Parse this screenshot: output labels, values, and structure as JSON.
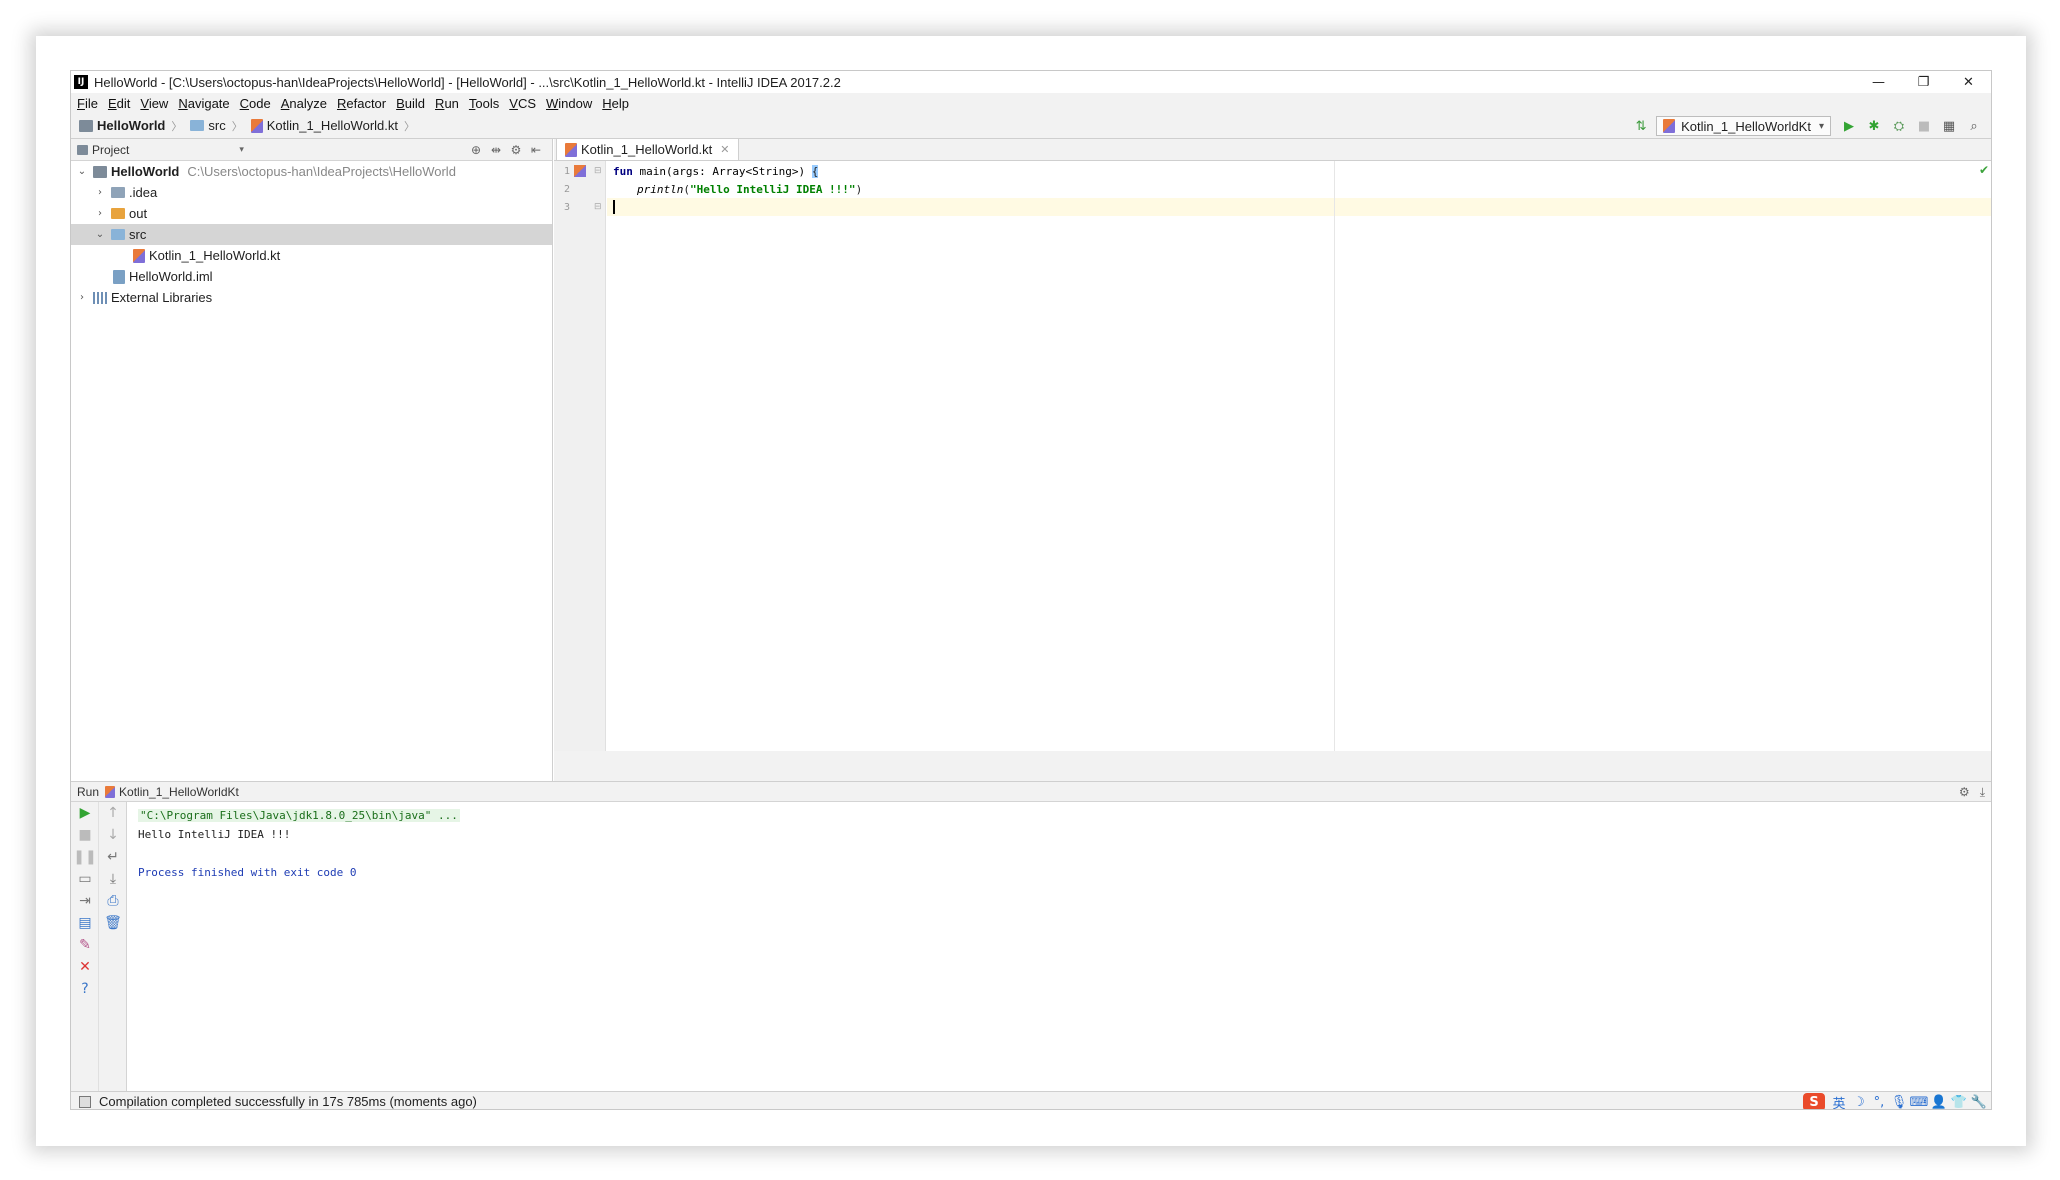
{
  "window": {
    "title": "HelloWorld - [C:\\Users\\octopus-han\\IdeaProjects\\HelloWorld] - [HelloWorld] - ...\\src\\Kotlin_1_HelloWorld.kt - IntelliJ IDEA 2017.2.2",
    "app_icon_text": "IJ",
    "minimize": "—",
    "restore": "❐",
    "close": "✕"
  },
  "menu": [
    "File",
    "Edit",
    "View",
    "Navigate",
    "Code",
    "Analyze",
    "Refactor",
    "Build",
    "Run",
    "Tools",
    "VCS",
    "Window",
    "Help"
  ],
  "breadcrumb": {
    "project": "HelloWorld",
    "folder": "src",
    "file": "Kotlin_1_HelloWorld.kt"
  },
  "toolbar": {
    "run_config": "Kotlin_1_HelloWorldKt"
  },
  "project_panel": {
    "title": "Project",
    "tree": {
      "root_name": "HelloWorld",
      "root_path": "C:\\Users\\octopus-han\\IdeaProjects\\HelloWorld",
      "idea": ".idea",
      "out": "out",
      "src": "src",
      "kt_file": "Kotlin_1_HelloWorld.kt",
      "iml_file": "HelloWorld.iml",
      "external": "External Libraries"
    }
  },
  "editor": {
    "tab_label": "Kotlin_1_HelloWorld.kt",
    "line_numbers": [
      "1",
      "2",
      "3"
    ],
    "code": {
      "l1_kw": "fun",
      "l1_rest": " main(args: Array<String>) ",
      "l1_brace": "{",
      "l2_call": "println",
      "l2_open": "(",
      "l2_str": "\"Hello IntelliJ IDEA !!!\"",
      "l2_close": ")"
    }
  },
  "run_panel": {
    "label": "Run",
    "config": "Kotlin_1_HelloWorldKt",
    "console": {
      "cmd": "\"C:\\Program Files\\Java\\jdk1.8.0_25\\bin\\java\" ...",
      "output": "Hello IntelliJ IDEA !!!",
      "finished": "Process finished with exit code 0"
    }
  },
  "status": {
    "message": "Compilation completed successfully in 17s 785ms (moments ago)",
    "tray_logo": "S",
    "tray_lang": "英"
  },
  "colors": {
    "accent_green": "#33a433",
    "string_green": "#008000",
    "keyword_navy": "#000080",
    "current_line": "#fffae3"
  }
}
